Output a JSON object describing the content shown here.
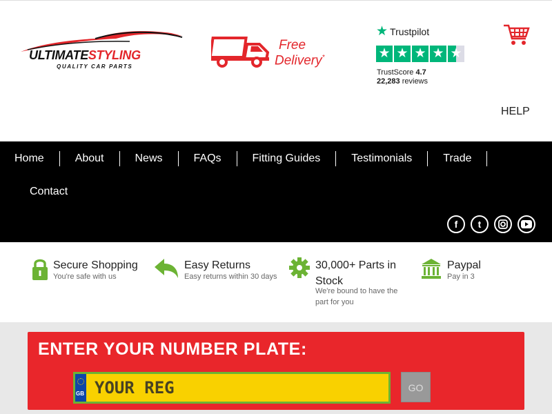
{
  "header": {
    "logo": {
      "name_part1": "ULTIMATE",
      "name_part2": "STYLING",
      "tagline": "QUALITY CAR PARTS"
    },
    "delivery": {
      "line1": "Free",
      "line2": "Delivery",
      "mark": "*"
    },
    "trustpilot": {
      "brand": "Trustpilot",
      "score_label": "TrustScore",
      "score": "4.7",
      "reviews_count": "22,283",
      "reviews_label": "reviews",
      "rating": 4.5,
      "star_color": "#00b67a"
    },
    "cart_icon": "shopping-cart-icon",
    "help_label": "HELP"
  },
  "nav": {
    "items": [
      "Home",
      "About",
      "News",
      "FAQs",
      "Fitting Guides",
      "Testimonials",
      "Trade"
    ],
    "items_row2": [
      "Contact"
    ],
    "socials": [
      "facebook-icon",
      "twitter-icon",
      "instagram-icon",
      "youtube-icon"
    ]
  },
  "features": [
    {
      "icon": "lock-icon",
      "title": "Secure Shopping",
      "subtitle": "You're safe with us"
    },
    {
      "icon": "return-arrow-icon",
      "title": "Easy Returns",
      "subtitle": "Easy returns within 30 days"
    },
    {
      "icon": "gear-icon",
      "title_line1": "30,000+ Parts in",
      "title_line2": "Stock",
      "subtitle_line1": "We're bound to have the",
      "subtitle_line2": "part for you"
    },
    {
      "icon": "bank-icon",
      "title": "Paypal",
      "subtitle": "Pay in 3"
    }
  ],
  "plate": {
    "heading": "ENTER YOUR NUMBER PLATE:",
    "placeholder": "YOUR REG",
    "country_code": "GB",
    "go_label": "GO"
  },
  "colors": {
    "brand_red": "#e3262b",
    "plate_yellow": "#f9d100",
    "feature_green": "#6cb334",
    "nav_black": "#000000"
  }
}
